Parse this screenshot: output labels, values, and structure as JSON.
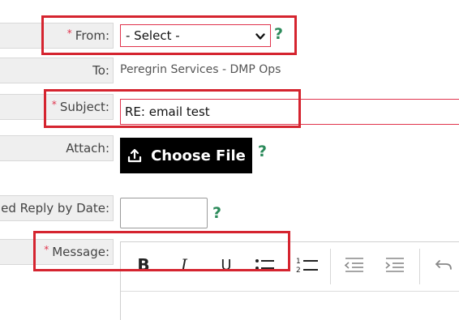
{
  "from": {
    "label": "From:",
    "required_marker": "*",
    "selected": "- Select -",
    "help": "?"
  },
  "to": {
    "label": "To:",
    "value": "Peregrin Services - DMP Ops"
  },
  "subject": {
    "label": "Subject:",
    "required_marker": "*",
    "value": "RE: email test"
  },
  "attach": {
    "label": "Attach:",
    "button_label": "Choose File",
    "help": "?"
  },
  "reply_by": {
    "label": "ed Reply by Date:",
    "value": "",
    "help": "?"
  },
  "message": {
    "label": "Message:",
    "required_marker": "*",
    "toolbar": {
      "bold": "B",
      "italic": "I",
      "underline": "U"
    }
  },
  "colors": {
    "required": "#e0334c",
    "help": "#2b8a5a",
    "highlight": "#d5242f"
  },
  "icons": [
    "chevron-down-icon",
    "help-icon",
    "upload-icon",
    "bold-icon",
    "italic-icon",
    "underline-icon",
    "bullet-list-icon",
    "numbered-list-icon",
    "outdent-icon",
    "indent-icon",
    "undo-icon"
  ]
}
